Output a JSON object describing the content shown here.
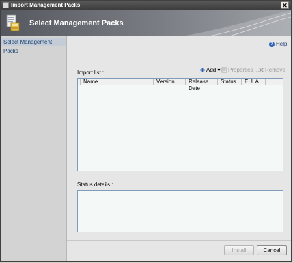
{
  "window": {
    "title": "Import Management Packs",
    "close_glyph": "✕"
  },
  "header": {
    "title": "Select Management Packs",
    "icon": "management-pack-icon"
  },
  "sidebar": {
    "items": [
      {
        "label": "Select Management Packs",
        "selected": true
      }
    ]
  },
  "help": {
    "label": "Help",
    "icon": "help-icon"
  },
  "import_list": {
    "label": "Import list :",
    "toolbar": {
      "add": {
        "label": "Add",
        "icon": "add-icon",
        "enabled": true
      },
      "properties": {
        "label": "Properties ...",
        "icon": "properties-icon",
        "enabled": false
      },
      "remove": {
        "label": "Remove",
        "icon": "remove-icon",
        "enabled": false
      }
    },
    "columns": [
      "Name",
      "Version",
      "Release Date",
      "Status",
      "EULA"
    ],
    "rows": []
  },
  "status_details": {
    "label": "Status details :"
  },
  "buttons": {
    "install": {
      "label": "Install",
      "enabled": false
    },
    "cancel": {
      "label": "Cancel",
      "enabled": true
    }
  },
  "colors": {
    "header_dark": "#55595f",
    "sidebar_selected": "#c4ccd7",
    "accent_blue": "#2f62b7"
  }
}
